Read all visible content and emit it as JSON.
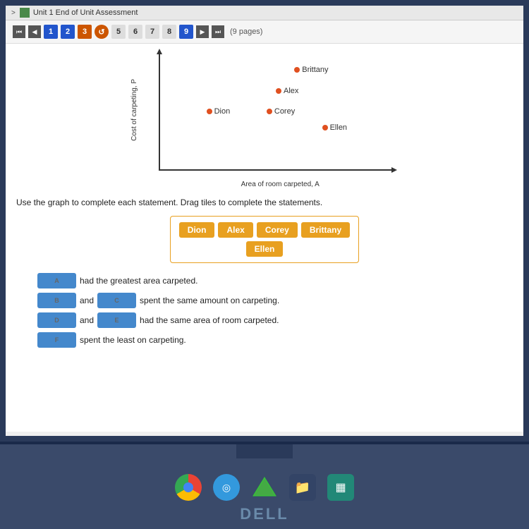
{
  "title_bar": {
    "arrow": ">",
    "label": "Unit 1 End of Unit Assessment"
  },
  "toolbar": {
    "nav_first": "⏮",
    "nav_prev": "◀",
    "pages": [
      {
        "num": "1",
        "style": "active-blue"
      },
      {
        "num": "2",
        "style": "active-blue"
      },
      {
        "num": "3",
        "style": "active-orange"
      },
      {
        "num": "↺",
        "style": "active-refresh"
      },
      {
        "num": "5",
        "style": "normal"
      },
      {
        "num": "6",
        "style": "normal"
      },
      {
        "num": "7",
        "style": "normal"
      },
      {
        "num": "8",
        "style": "normal"
      },
      {
        "num": "9",
        "style": "active-nav"
      }
    ],
    "nav_next": "▶",
    "nav_last": "⏭",
    "pages_label": "(9 pages)"
  },
  "graph": {
    "y_axis_label": "Cost of carpeting, P",
    "x_axis_label": "Area of room carpeted, A",
    "data_points": [
      {
        "name": "Brittany",
        "x_pct": 62,
        "y_pct": 15
      },
      {
        "name": "Alex",
        "x_pct": 55,
        "y_pct": 32
      },
      {
        "name": "Dion",
        "x_pct": 28,
        "y_pct": 50
      },
      {
        "name": "Corey",
        "x_pct": 55,
        "y_pct": 50
      },
      {
        "name": "Ellen",
        "x_pct": 75,
        "y_pct": 62
      }
    ]
  },
  "instruction": "Use the graph to complete each statement. Drag tiles to complete the statements.",
  "tiles": {
    "row1": [
      "Dion",
      "Alex",
      "Corey",
      "Brittany"
    ],
    "row2": [
      "Ellen"
    ]
  },
  "statements": [
    {
      "id": "A",
      "prefix": "",
      "slot1": "A",
      "text": "had the greatest area carpeted."
    },
    {
      "id": "B",
      "prefix": "",
      "slot1": "B",
      "conjunction": "and",
      "slot2": "C",
      "text": "spent the same amount on carpeting."
    },
    {
      "id": "D",
      "prefix": "",
      "slot1": "D",
      "conjunction": "and",
      "slot2": "E",
      "text": "had the same area of room carpeted."
    },
    {
      "id": "F",
      "prefix": "",
      "slot1": "F",
      "text": "spent the least on carpeting."
    }
  ],
  "taskbar": {
    "icons": [
      "chrome",
      "blue",
      "green",
      "dark",
      "teal"
    ],
    "dell_label": "DELL"
  }
}
